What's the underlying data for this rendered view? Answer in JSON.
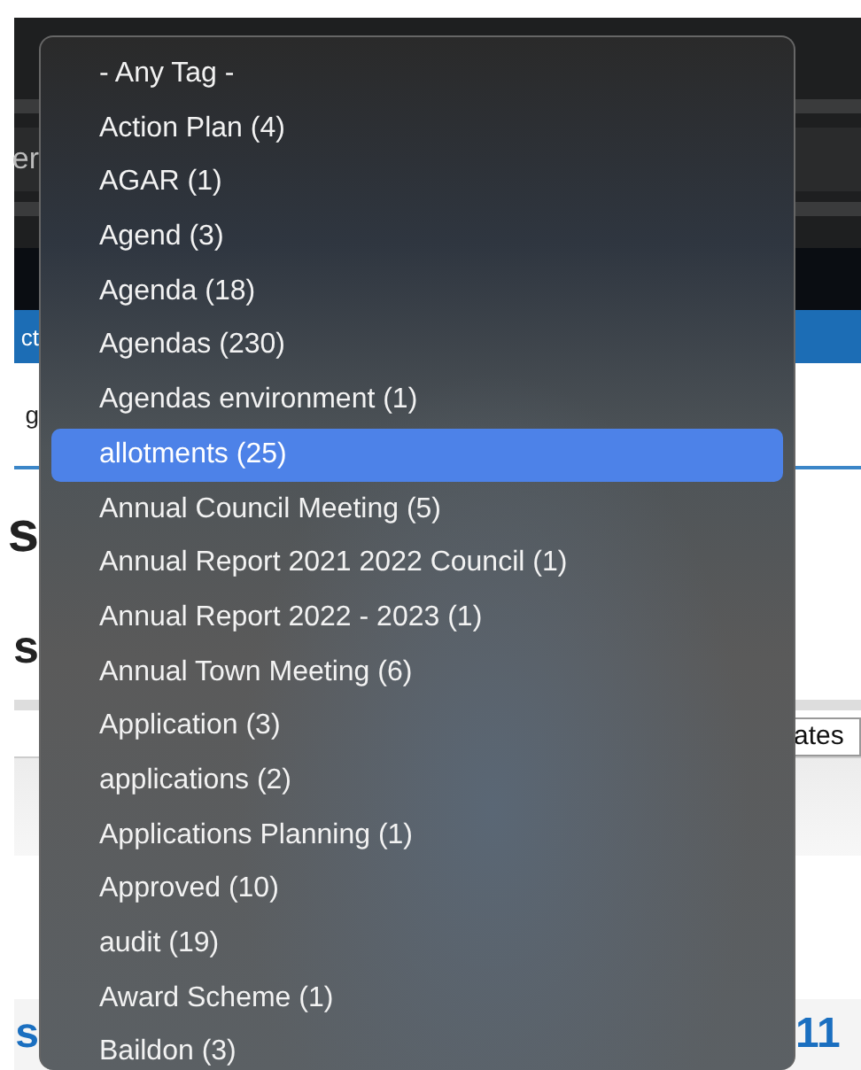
{
  "background_page": {
    "left_fragments": [
      {
        "kind": "field",
        "text": "er"
      },
      {
        "kind": "nav",
        "text": "ct"
      },
      {
        "kind": "plain",
        "text": "g"
      },
      {
        "kind": "heading",
        "text": "s"
      },
      {
        "kind": "subheading",
        "text": "s"
      },
      {
        "kind": "link",
        "text": "s"
      }
    ],
    "right_fragments": [
      {
        "kind": "field",
        "text": "ates"
      },
      {
        "kind": "link",
        "text": "11"
      }
    ]
  },
  "tag_menu": {
    "items": [
      {
        "label": "- Any Tag -",
        "selected": false
      },
      {
        "label": "Action Plan (4)",
        "selected": false
      },
      {
        "label": "AGAR (1)",
        "selected": false
      },
      {
        "label": "Agend (3)",
        "selected": false
      },
      {
        "label": "Agenda (18)",
        "selected": false
      },
      {
        "label": "Agendas (230)",
        "selected": false
      },
      {
        "label": "Agendas environment (1)",
        "selected": false
      },
      {
        "label": "allotments (25)",
        "selected": true
      },
      {
        "label": "Annual Council Meeting (5)",
        "selected": false
      },
      {
        "label": "Annual Report 2021 2022 Council (1)",
        "selected": false
      },
      {
        "label": "Annual Report 2022 - 2023 (1)",
        "selected": false
      },
      {
        "label": "Annual Town Meeting (6)",
        "selected": false
      },
      {
        "label": "Application (3)",
        "selected": false
      },
      {
        "label": "applications (2)",
        "selected": false
      },
      {
        "label": "Applications Planning (1)",
        "selected": false
      },
      {
        "label": "Approved (10)",
        "selected": false
      },
      {
        "label": "audit (19)",
        "selected": false
      },
      {
        "label": "Award Scheme (1)",
        "selected": false
      },
      {
        "label": "Baildon (3)",
        "selected": false
      }
    ]
  }
}
